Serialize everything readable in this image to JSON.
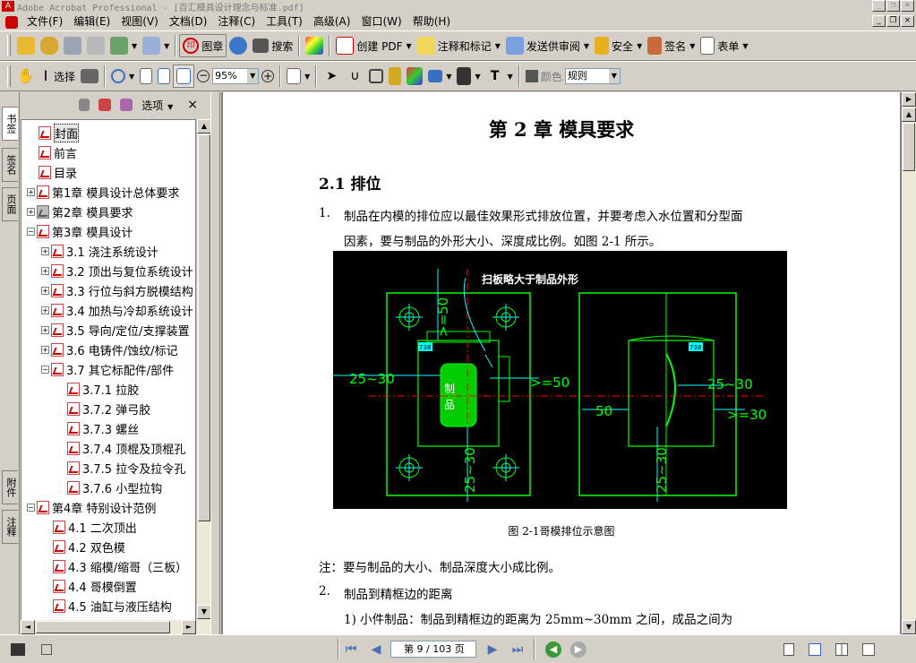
{
  "window": {
    "title": "Adobe Acrobat Professional - [百汇模具设计理念与标准.pdf]",
    "min_label": "_",
    "restore_label": "❐",
    "close_label": "×"
  },
  "menu": [
    "文件(F)",
    "编辑(E)",
    "视图(V)",
    "文档(D)",
    "注释(C)",
    "工具(T)",
    "高级(A)",
    "窗口(W)",
    "帮助(H)"
  ],
  "toolbar1": {
    "stamp": "图章",
    "search": "搜索",
    "create_pdf": "创建 PDF",
    "comment_markup": "注释和标记",
    "send_review": "发送供审阅",
    "security": "安全",
    "sign": "签名",
    "forms": "表单"
  },
  "toolbar2": {
    "select": "选择",
    "zoom": "95%",
    "color": "颜色",
    "style": "规则"
  },
  "nav_tabs": [
    "书签",
    "签名",
    "页面",
    "附件",
    "注释"
  ],
  "bookmarks_panel": {
    "options": "选项",
    "close": "×",
    "items": [
      {
        "label": "封面",
        "level": 0,
        "expander": "",
        "selected": true
      },
      {
        "label": "前言",
        "level": 0,
        "expander": ""
      },
      {
        "label": "目录",
        "level": 0,
        "expander": ""
      },
      {
        "label": "第1章 模具设计总体要求",
        "level": 0,
        "expander": "+"
      },
      {
        "label": "第2章 模具要求",
        "level": 0,
        "expander": "+",
        "gray": true
      },
      {
        "label": "第3章 模具设计",
        "level": 0,
        "expander": "−"
      },
      {
        "label": "3.1 浇注系统设计",
        "level": 1,
        "expander": "+"
      },
      {
        "label": "3.2 顶出与复位系统设计",
        "level": 1,
        "expander": "+"
      },
      {
        "label": "3.3 行位与斜方脱模结构",
        "level": 1,
        "expander": "+"
      },
      {
        "label": "3.4 加热与冷却系统设计",
        "level": 1,
        "expander": "+"
      },
      {
        "label": "3.5 导向/定位/支撑装置",
        "level": 1,
        "expander": "+"
      },
      {
        "label": "3.6 电铸件/蚀纹/标记",
        "level": 1,
        "expander": "+"
      },
      {
        "label": "3.7 其它标配件/部件",
        "level": 1,
        "expander": "−"
      },
      {
        "label": "3.7.1 拉胶",
        "level": 2,
        "expander": ""
      },
      {
        "label": "3.7.2 弹弓胶",
        "level": 2,
        "expander": ""
      },
      {
        "label": "3.7.3 螺丝",
        "level": 2,
        "expander": ""
      },
      {
        "label": "3.7.4 顶棍及顶棍孔",
        "level": 2,
        "expander": ""
      },
      {
        "label": "3.7.5 拉令及拉令孔",
        "level": 2,
        "expander": ""
      },
      {
        "label": "3.7.6 小型拉钩",
        "level": 2,
        "expander": ""
      },
      {
        "label": "第4章 特别设计范例",
        "level": 0,
        "expander": "−"
      },
      {
        "label": "4.1 二次顶出",
        "level": 1,
        "expander": ""
      },
      {
        "label": "4.2 双色模",
        "level": 1,
        "expander": ""
      },
      {
        "label": "4.3 缩模/缩哥（三板）",
        "level": 1,
        "expander": ""
      },
      {
        "label": "4.4 哥模倒置",
        "level": 1,
        "expander": ""
      },
      {
        "label": "4.5 油缸与液压结构",
        "level": 1,
        "expander": ""
      }
    ]
  },
  "document": {
    "chapter_title": "第 2 章  模具要求",
    "section_title": "2.1 排位",
    "item1_num": "1.",
    "item1_line1": "制品在内模的排位应以最佳效果形式排放位置，并要考虑入水位置和分型面",
    "item1_line2": "因素，要与制品的外形大小、深度成比例。如图 2-1 所示。",
    "figure": {
      "annotation_top": "扫板略大于制品外形",
      "dim_50_top": ">=50",
      "dim_25_30_left": "25~30",
      "dim_50_right": ">=50",
      "dim_25_30_bottom": "25~30",
      "part_label": "制\n品",
      "part_label_1": "制",
      "part_label_2": "品",
      "tag": "738",
      "dim_25_30_right": "25~30",
      "dim_50_left2": "50",
      "dim_30_right2": ">=30",
      "dim_25_30_bottom2": "25~30"
    },
    "caption": "图  2-1哥模排位示意图",
    "note": "注：要与制品的大小、制品深度大小成比例。",
    "item2_num": "2.",
    "item2_text": "制品到精框边的距离",
    "item2_1": "1)   小件制品：制品到精框边的距离为  25mm~30mm  之间，成品之间为"
  },
  "statusbar": {
    "page_field": "第 9 / 103 页"
  },
  "colors": {
    "accent": "#316ac5",
    "cad_green": "#00ff00",
    "cad_cyan": "#00ffff",
    "cad_red": "#ff0000",
    "cad_bg": "#000000"
  }
}
